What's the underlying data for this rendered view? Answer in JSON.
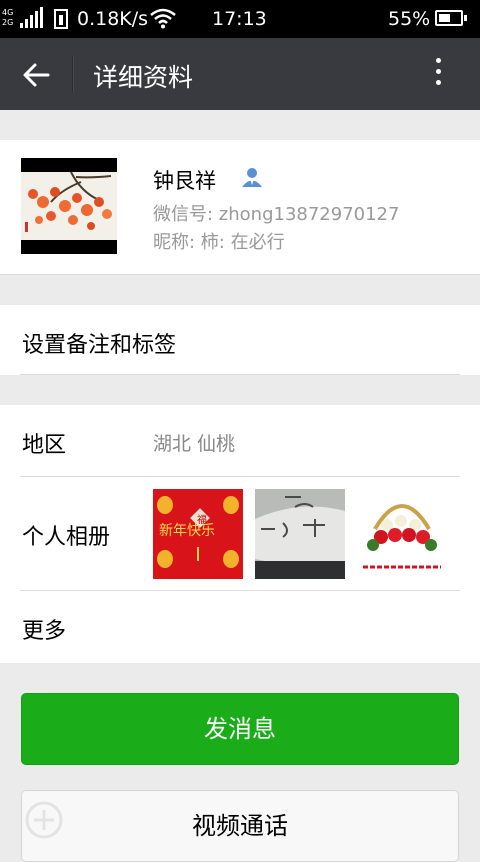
{
  "status_bar": {
    "network_labels": [
      "4G",
      "2G"
    ],
    "speed": "0.18K/s",
    "time": "17:13",
    "battery_percent_text": "55%",
    "battery_level": 0.55
  },
  "title_bar": {
    "title": "详细资料"
  },
  "profile": {
    "name": "钟艮祥",
    "wechat_id": "微信号: zhong13872970127",
    "nickname": "昵称: 柿: 在必行"
  },
  "remark": {
    "label": "设置备注和标签"
  },
  "details": {
    "region_label": "地区",
    "region_value": "湖北  仙桃",
    "album_label": "个人相册",
    "album_photos": [
      "new-year-lanterns-photo",
      "snow-writing-photo",
      "rose-basket-photo"
    ],
    "more_label": "更多"
  },
  "actions": {
    "message_button": "发消息",
    "video_call_button": "视频通话"
  },
  "colors": {
    "status_bar": "#000000",
    "title_bar": "#393a3f",
    "page_bg": "#ebebeb",
    "primary_button": "#1aad19"
  }
}
